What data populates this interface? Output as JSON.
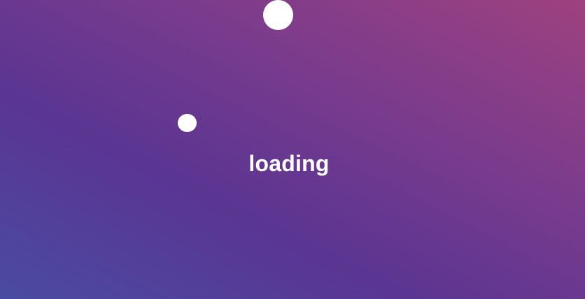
{
  "loader": {
    "label": "loading"
  },
  "colors": {
    "background_start": "#4a4ba2",
    "background_mid": "#5a3592",
    "background_end": "#9e417f",
    "dot": "#ffffff",
    "text": "#ffffff"
  }
}
